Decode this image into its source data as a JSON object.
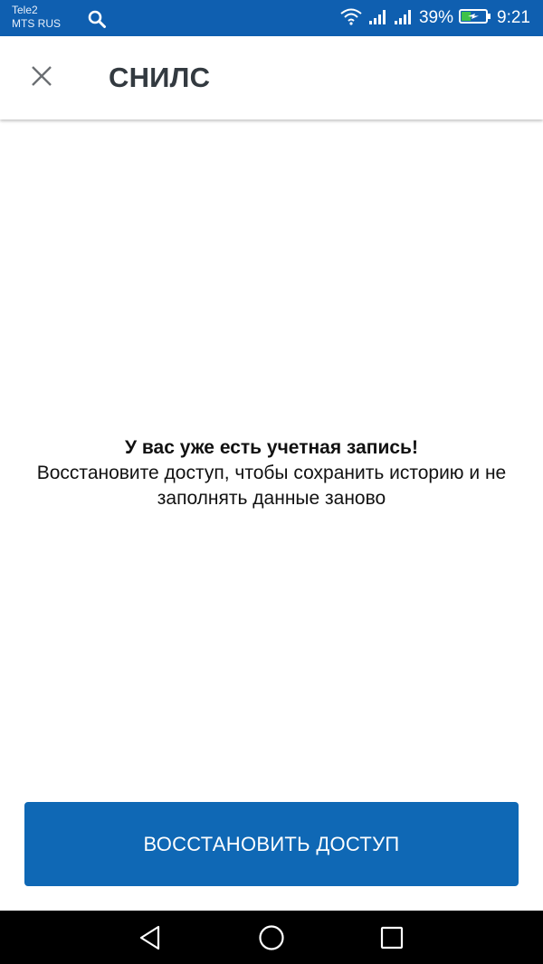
{
  "status_bar": {
    "carrier_1": "Tele2",
    "carrier_2": "MTS RUS",
    "battery_percent": "39%",
    "time": "9:21",
    "battery_level": 0.39,
    "icons": [
      "search-icon",
      "wifi-icon",
      "signal-icon",
      "signal-icon",
      "battery-charging-icon"
    ]
  },
  "app_bar": {
    "title": "СНИЛС",
    "close_icon": "close-icon"
  },
  "message": {
    "title": "У вас уже есть учетная запись!",
    "body": "Восстановите доступ, чтобы сохранить историю и не заполнять данные заново"
  },
  "primary_button": {
    "label": "ВОССТАНОВИТЬ ДОСТУП",
    "color": "#0f68b5"
  },
  "nav_bar": {
    "icons": [
      "back-icon",
      "home-icon",
      "recents-icon"
    ]
  },
  "colors": {
    "status_bar": "#0f5fb0",
    "title_text": "#333a40",
    "accent": "#0f68b5"
  }
}
